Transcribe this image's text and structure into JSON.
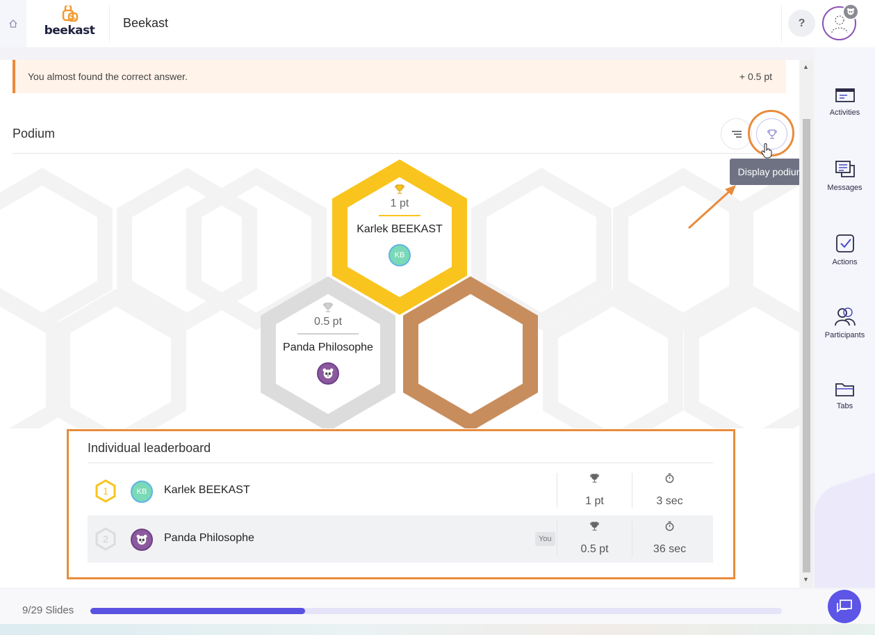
{
  "header": {
    "logo_text": "beekast",
    "title": "Beekast",
    "help_label": "?"
  },
  "alert": {
    "message": "You almost found the correct answer.",
    "points": "+ 0.5 pt"
  },
  "podium": {
    "title": "Podium",
    "tooltip": "Display podium",
    "first": {
      "points": "1 pt",
      "name": "Karlek BEEKAST",
      "initials": "KB"
    },
    "second": {
      "points": "0.5 pt",
      "name": "Panda Philosophe"
    }
  },
  "leaderboard": {
    "title": "Individual leaderboard",
    "rows": [
      {
        "rank": "1",
        "initials": "KB",
        "name": "Karlek BEEKAST",
        "points": "1 pt",
        "time": "3 sec",
        "you": ""
      },
      {
        "rank": "2",
        "initials": "",
        "name": "Panda Philosophe",
        "points": "0.5 pt",
        "time": "36 sec",
        "you": "You"
      }
    ]
  },
  "nav": {
    "items": [
      {
        "label": "Activities",
        "icon": "activities-icon"
      },
      {
        "label": "Messages",
        "icon": "messages-icon"
      },
      {
        "label": "Actions",
        "icon": "actions-icon"
      },
      {
        "label": "Participants",
        "icon": "participants-icon"
      },
      {
        "label": "Tabs",
        "icon": "tabs-icon"
      }
    ]
  },
  "progress": {
    "label": "9/29 Slides",
    "current": 9,
    "total": 29
  },
  "colors": {
    "gold": "#f9c41d",
    "silver": "#dcdcdc",
    "bronze": "#c88d5d",
    "accent": "#5a52e0",
    "highlight": "#e98b3b",
    "kb_avatar": "#7ad9b6",
    "panda_avatar": "#8b5a9e"
  }
}
